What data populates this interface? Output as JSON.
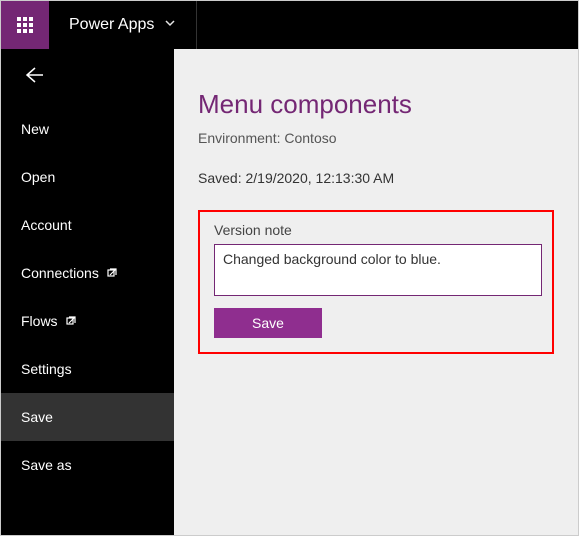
{
  "header": {
    "brand": "Power Apps"
  },
  "sidebar": {
    "items": [
      {
        "label": "New"
      },
      {
        "label": "Open"
      },
      {
        "label": "Account"
      },
      {
        "label": "Connections"
      },
      {
        "label": "Flows"
      },
      {
        "label": "Settings"
      },
      {
        "label": "Save"
      },
      {
        "label": "Save as"
      }
    ]
  },
  "main": {
    "title": "Menu components",
    "environment_line": "Environment: Contoso",
    "saved_line": "Saved: 2/19/2020, 12:13:30 AM",
    "version_note_label": "Version note",
    "version_note_value": "Changed background color to blue.",
    "save_button": "Save"
  },
  "colors": {
    "accent": "#742774"
  }
}
